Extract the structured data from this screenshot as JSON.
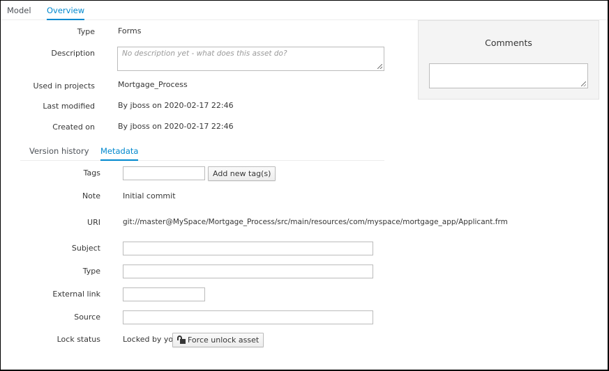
{
  "top_tabs": [
    {
      "label": "Model",
      "active": false
    },
    {
      "label": "Overview",
      "active": true
    }
  ],
  "overview": {
    "type_label": "Type",
    "type_value": "Forms",
    "description_label": "Description",
    "description_placeholder": "No description yet - what does this asset do?",
    "description_value": "",
    "used_in_projects_label": "Used in projects",
    "used_in_projects_value": "Mortgage_Process",
    "last_modified_label": "Last modified",
    "last_modified_value": "By jboss on 2020-02-17 22:46",
    "created_on_label": "Created on",
    "created_on_value": "By jboss on 2020-02-17 22:46"
  },
  "comments": {
    "title": "Comments",
    "input_value": ""
  },
  "sub_tabs": [
    {
      "label": "Version history",
      "active": false
    },
    {
      "label": "Metadata",
      "active": true
    }
  ],
  "metadata": {
    "tags_label": "Tags",
    "tags_value": "",
    "add_tags_button": "Add new tag(s)",
    "note_label": "Note",
    "note_value": "Initial commit",
    "uri_label": "URI",
    "uri_value": "git://master@MySpace/Mortgage_Process/src/main/resources/com/myspace/mortgage_app/Applicant.frm",
    "subject_label": "Subject",
    "subject_value": "",
    "type_label": "Type",
    "type_value": "",
    "external_link_label": "External link",
    "external_link_value": "",
    "source_label": "Source",
    "source_value": "",
    "lock_status_label": "Lock status",
    "lock_status_value": "Locked by you",
    "force_unlock_button": "Force unlock asset"
  },
  "colors": {
    "accent": "#0088ce",
    "panel_bg": "#f4f4f4"
  }
}
